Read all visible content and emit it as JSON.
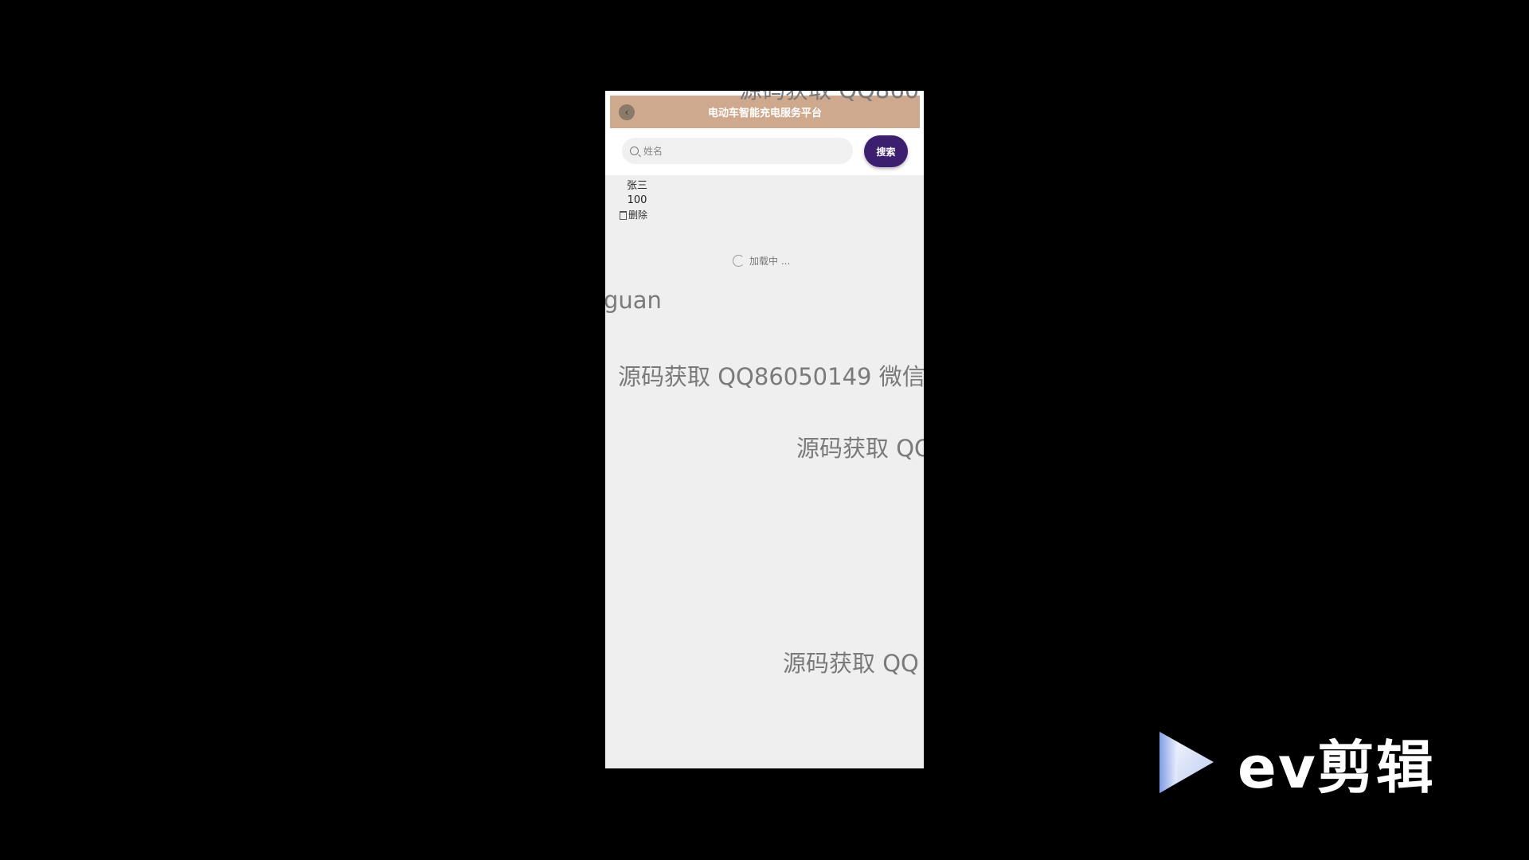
{
  "header": {
    "title": "电动车智能充电服务平台"
  },
  "search": {
    "placeholder": "姓名",
    "button_label": "搜索"
  },
  "record": {
    "name": "张三",
    "value": "100",
    "delete_label": "删除"
  },
  "loading_text": "加载中 ...",
  "watermarks": [
    "源码获取 QQ860",
    "guan",
    "源码获取 QQ86050149 微信",
    "源码获取 QQ",
    "源码获取 QQ"
  ],
  "logo_text": "ev剪辑",
  "colors": {
    "header": "#cfa98e",
    "search_button": "#3c1f6e",
    "page_bg": "#efefef"
  }
}
